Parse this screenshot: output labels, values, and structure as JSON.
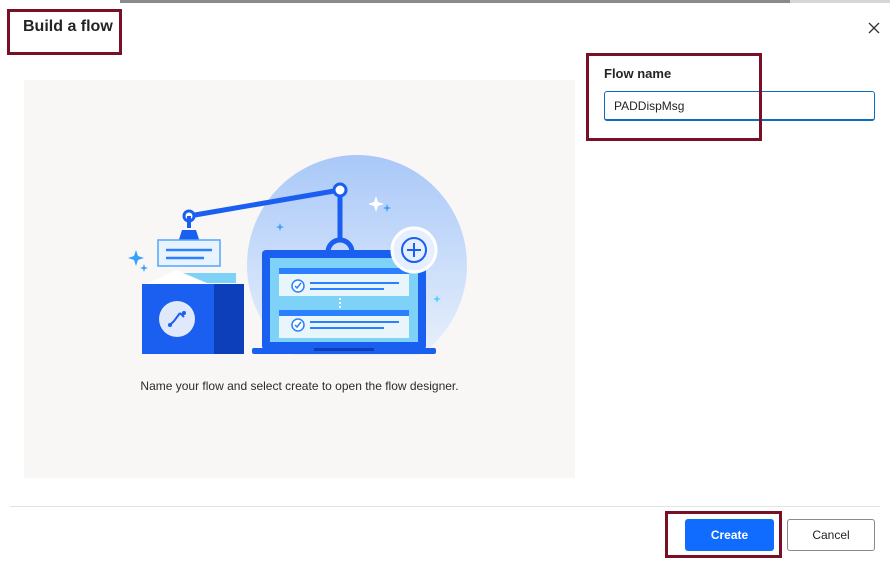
{
  "dialog": {
    "title": "Build a flow",
    "close_icon": "close-icon"
  },
  "illustration": {
    "caption": "Name your flow and select create to open the flow designer."
  },
  "form": {
    "flow_name_label": "Flow name",
    "flow_name_value": "PADDispMsg"
  },
  "footer": {
    "create_label": "Create",
    "cancel_label": "Cancel"
  },
  "colors": {
    "accent": "#0f6cff",
    "highlight_border": "#7a1026"
  }
}
